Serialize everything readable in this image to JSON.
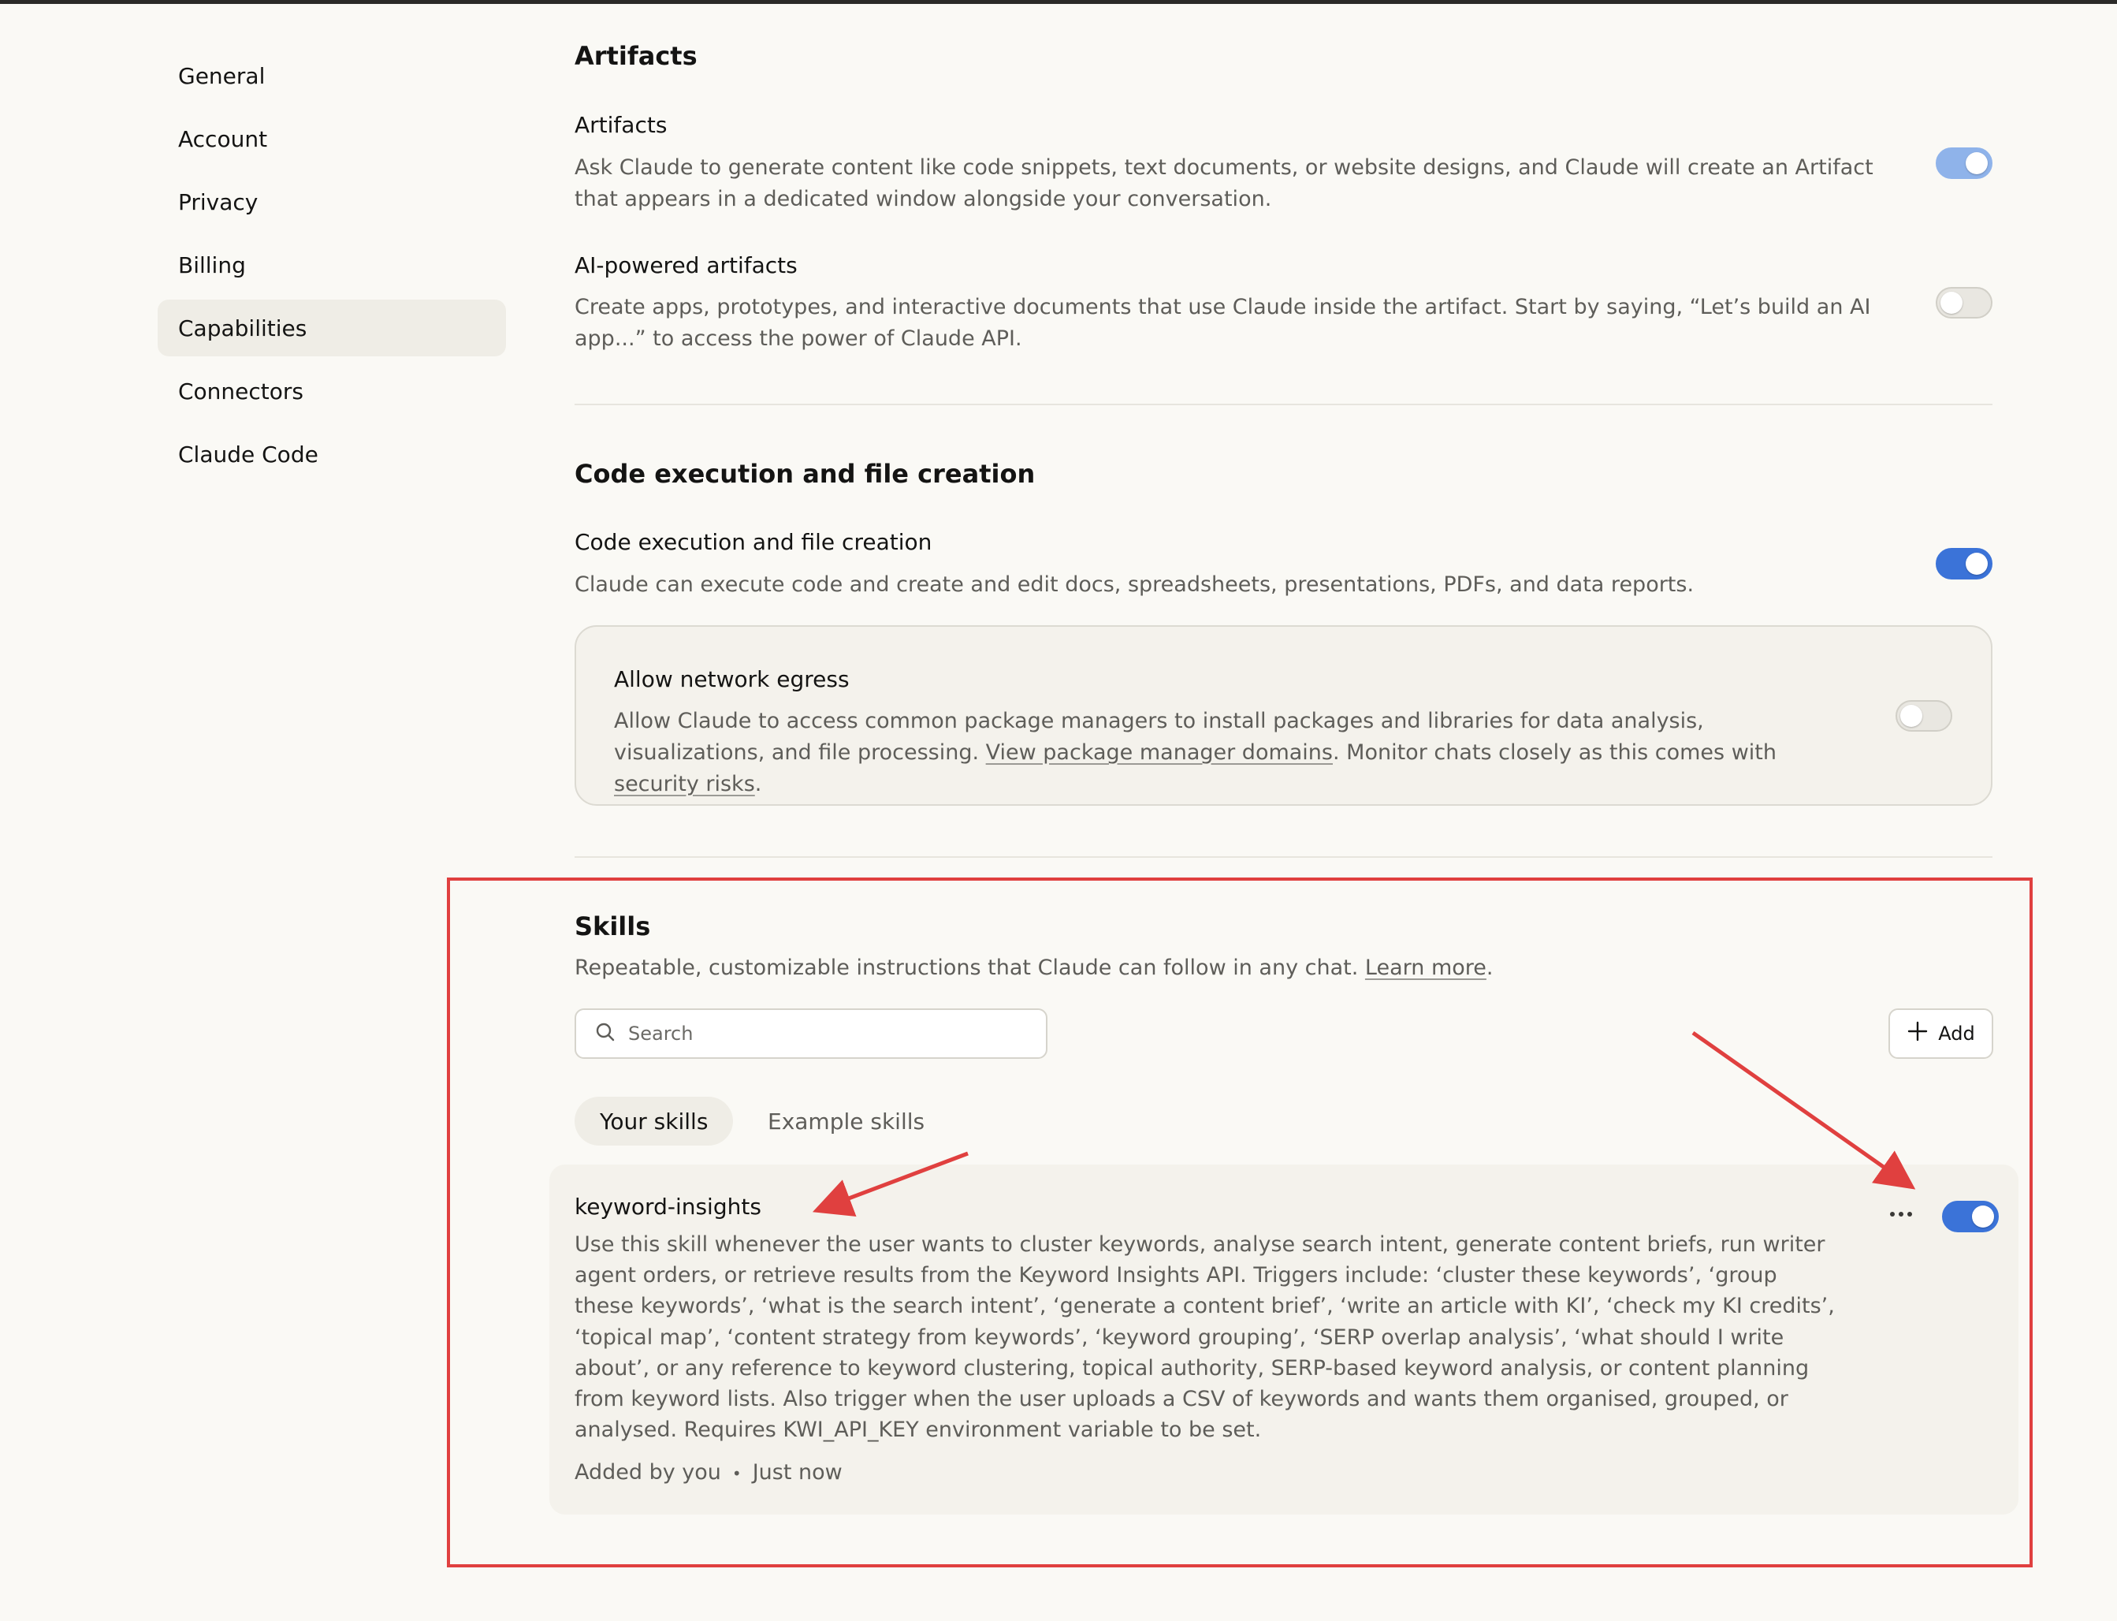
{
  "sidebar": {
    "items": [
      {
        "label": "General",
        "active": false
      },
      {
        "label": "Account",
        "active": false
      },
      {
        "label": "Privacy",
        "active": false
      },
      {
        "label": "Billing",
        "active": false
      },
      {
        "label": "Capabilities",
        "active": true
      },
      {
        "label": "Connectors",
        "active": false
      },
      {
        "label": "Claude Code",
        "active": false
      }
    ]
  },
  "artifacts": {
    "heading": "Artifacts",
    "artifacts_row": {
      "title": "Artifacts",
      "description": "Ask Claude to generate content like code snippets, text documents, or website designs, and Claude will create an Artifact that appears in a dedicated window alongside your conversation.",
      "enabled": true
    },
    "ai_row": {
      "title": "AI-powered artifacts",
      "description": "Create apps, prototypes, and interactive documents that use Claude inside the artifact. Start by saying, “Let’s build an AI app...” to access the power of Claude API.",
      "enabled": false
    }
  },
  "code_execution": {
    "heading": "Code execution and file creation",
    "row": {
      "title": "Code execution and file creation",
      "description": "Claude can execute code and create and edit docs, spreadsheets, presentations, PDFs, and data reports.",
      "enabled": true
    },
    "egress": {
      "title": "Allow network egress",
      "desc_part1": "Allow Claude to access common package managers to install packages and libraries for data analysis, visualizations, and file processing. ",
      "link1": "View package manager domains",
      "desc_part2": ". Monitor chats closely as this comes with ",
      "link2": "security risks",
      "desc_part3": ".",
      "enabled": false
    }
  },
  "skills": {
    "heading": "Skills",
    "desc": "Repeatable, customizable instructions that Claude can follow in any chat. ",
    "learn_more": "Learn more",
    "desc_end": ".",
    "search_placeholder": "Search",
    "add_label": "Add",
    "tabs": [
      {
        "label": "Your skills",
        "active": true
      },
      {
        "label": "Example skills",
        "active": false
      }
    ],
    "items": [
      {
        "name": "keyword-insights",
        "description": "Use this skill whenever the user wants to cluster keywords, analyse search intent, generate content briefs, run writer agent orders, or retrieve results from the Keyword Insights API. Triggers include: ‘cluster these keywords’, ‘group these keywords’, ‘what is the search intent’, ‘generate a content brief’, ‘write an article with KI’, ‘check my KI credits’, ‘topical map’, ‘content strategy from keywords’, ‘keyword grouping’, ‘SERP overlap analysis’, ‘what should I write about’, or any reference to keyword clustering, topical authority, SERP-based keyword analysis, or content planning from keyword lists. Also trigger when the user uploads a CSV of keywords and wants them organised, grouped, or analysed. Requires KWI_API_KEY environment variable to be set.",
        "added_by": "Added by you",
        "separator": "•",
        "added_when": "Just now",
        "enabled": true
      }
    ]
  },
  "colors": {
    "toggle_on": "#3b73d8",
    "annotation": "#e0403f"
  }
}
